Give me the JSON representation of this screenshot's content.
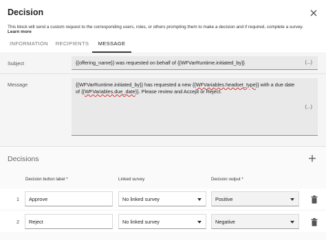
{
  "dialog": {
    "title": "Decision",
    "description": "This block will send a custom request to the corresponding users, roles, or others prompting them to make a decision and if required, complete a survey.",
    "learn_more": "Learn more"
  },
  "tabs": [
    {
      "label": "INFORMATION",
      "active": false
    },
    {
      "label": "RECIPIENTS",
      "active": false
    },
    {
      "label": "MESSAGE",
      "active": true
    }
  ],
  "subject": {
    "label": "Subject",
    "value": "{{offering_name}} was requested on behalf of {{WFVarRuntime.initiated_by}}",
    "more": "(...)"
  },
  "message": {
    "label": "Message",
    "part1": "{{WFVarRuntime.initiated_by}} has requested a new {{",
    "var1": "WFVariables.headset_type",
    "part2": "}} with a due date",
    "part3": "of {{",
    "var2": "WFVariables.due_date",
    "part4": "}}.  Please review and Accept or Reject.",
    "more": "(...)"
  },
  "decisions": {
    "title": "Decisions",
    "columns": {
      "label": "Decision button label",
      "survey": "Linked survey",
      "output": "Decision output",
      "required_mark": "*"
    },
    "rows": [
      {
        "num": "1",
        "label": "Approve",
        "survey": "No linked survey",
        "output": "Positive"
      },
      {
        "num": "2",
        "label": "Reject",
        "survey": "No linked survey",
        "output": "Negative"
      }
    ]
  },
  "colors": {
    "accent": "#3a3a3a",
    "spell_error": "#d32f2f"
  }
}
